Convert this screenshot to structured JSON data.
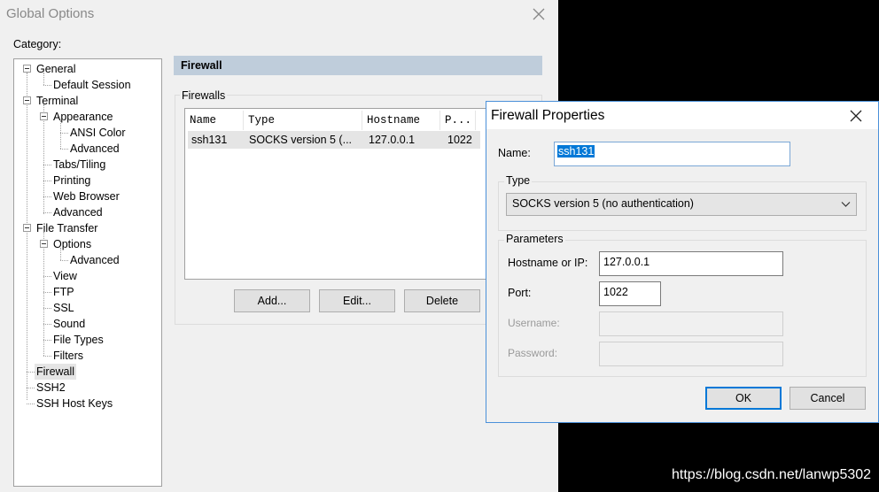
{
  "global_options": {
    "title": "Global Options",
    "category_label": "Category:",
    "tree": [
      {
        "label": "General"
      },
      {
        "label": "Default Session"
      },
      {
        "label": "Terminal"
      },
      {
        "label": "Appearance"
      },
      {
        "label": "ANSI Color"
      },
      {
        "label": "Advanced"
      },
      {
        "label": "Tabs/Tiling"
      },
      {
        "label": "Printing"
      },
      {
        "label": "Web Browser"
      },
      {
        "label": "Advanced"
      },
      {
        "label": "File Transfer"
      },
      {
        "label": "Options"
      },
      {
        "label": "Advanced"
      },
      {
        "label": "View"
      },
      {
        "label": "FTP"
      },
      {
        "label": "SSL"
      },
      {
        "label": "Sound"
      },
      {
        "label": "File Types"
      },
      {
        "label": "Filters"
      },
      {
        "label": "Firewall"
      },
      {
        "label": "SSH2"
      },
      {
        "label": "SSH Host Keys"
      }
    ],
    "selected_item": "Firewall",
    "panel_title": "Firewall",
    "firewalls_group": "Firewalls",
    "columns": [
      "Name",
      "Type",
      "Hostname",
      "P..."
    ],
    "rows": [
      {
        "name": "ssh131",
        "type": "SOCKS version 5 (...",
        "hostname": "127.0.0.1",
        "port": "1022"
      }
    ],
    "buttons": {
      "add": "Add...",
      "edit": "Edit...",
      "delete": "Delete"
    }
  },
  "firewall_properties": {
    "title": "Firewall Properties",
    "name_label": "Name:",
    "name_value": "ssh131",
    "type_group": "Type",
    "type_value": "SOCKS version 5 (no authentication)",
    "params_group": "Parameters",
    "hostname_label": "Hostname or IP:",
    "hostname_value": "127.0.0.1",
    "port_label": "Port:",
    "port_value": "1022",
    "username_label": "Username:",
    "password_label": "Password:",
    "ok": "OK",
    "cancel": "Cancel"
  },
  "watermark": "https://blog.csdn.net/lanwp5302",
  "colors": {
    "selection": "#0078d7",
    "header_bar": "#bfcddb",
    "dialog_border": "#4a90d9"
  }
}
